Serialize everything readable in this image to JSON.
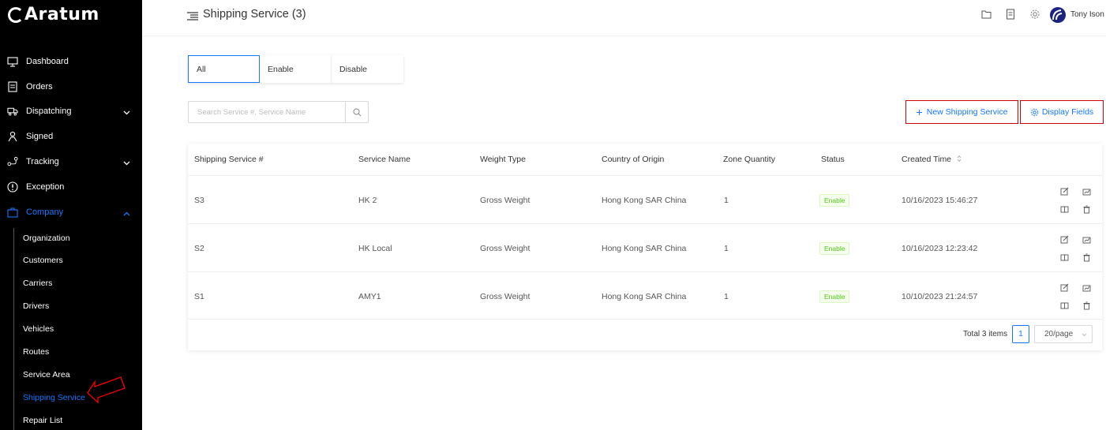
{
  "app": {
    "logo_text": "Aratum"
  },
  "sidebar": {
    "items": [
      {
        "label": "Dashboard",
        "icon": "monitor-icon"
      },
      {
        "label": "Orders",
        "icon": "document-icon"
      },
      {
        "label": "Dispatching",
        "icon": "truck-icon",
        "expandable": true
      },
      {
        "label": "Signed",
        "icon": "signature-icon"
      },
      {
        "label": "Tracking",
        "icon": "route-icon",
        "expandable": true
      },
      {
        "label": "Exception",
        "icon": "exclamation-icon"
      },
      {
        "label": "Company",
        "icon": "company-icon",
        "expandable": true,
        "expanded": true
      }
    ],
    "subitems": [
      "Organization",
      "Customers",
      "Carriers",
      "Drivers",
      "Vehicles",
      "Routes",
      "Service Area",
      "Shipping Service",
      "Repair List"
    ],
    "active_subitem": "Shipping Service"
  },
  "header": {
    "title": "Shipping Service (3)",
    "icons": [
      "folder-icon",
      "file-icon",
      "gear-icon"
    ],
    "user_name": "Tony Ison"
  },
  "filter_tabs": {
    "options": [
      "All",
      "Enable",
      "Disable"
    ],
    "selected": "All"
  },
  "search": {
    "placeholder": "Search Service #, Service Name"
  },
  "buttons": {
    "new_service": "New Shipping Service",
    "display_fields": "Display Fields"
  },
  "table": {
    "columns": [
      "Shipping Service #",
      "Service Name",
      "Weight Type",
      "Country of Origin",
      "Zone Quantity",
      "Status",
      "Created Time"
    ],
    "rows": [
      {
        "id": "S3",
        "name": "HK 2",
        "weight_type": "Gross Weight",
        "country": "Hong Kong SAR China",
        "zones": "1",
        "status": "Enable",
        "created": "10/16/2023 15:46:27"
      },
      {
        "id": "S2",
        "name": "HK Local",
        "weight_type": "Gross Weight",
        "country": "Hong Kong SAR China",
        "zones": "1",
        "status": "Enable",
        "created": "10/16/2023 12:23:42"
      },
      {
        "id": "S1",
        "name": "AMY1",
        "weight_type": "Gross Weight",
        "country": "Hong Kong SAR China",
        "zones": "1",
        "status": "Enable",
        "created": "10/10/2023 21:24:57"
      }
    ]
  },
  "pagination": {
    "total": "Total 3 items",
    "current_page": "1",
    "page_size": "20/page"
  },
  "colors": {
    "accent": "#1677ff",
    "sidebar_bg": "#000000",
    "highlight_border": "#cc0000",
    "status_green": "#52c41a"
  }
}
